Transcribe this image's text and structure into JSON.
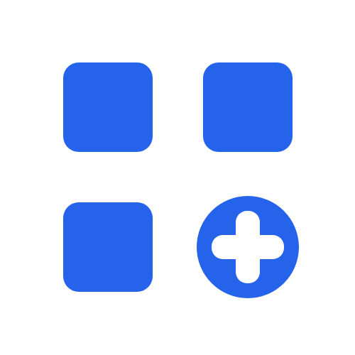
{
  "icon": {
    "name": "grid-add-icon",
    "color": "#2563EB",
    "foreground": "#FFFFFF",
    "background": "#FFFFFF",
    "tiles": [
      {
        "name": "square-icon"
      },
      {
        "name": "square-icon"
      },
      {
        "name": "square-icon"
      }
    ],
    "badge": {
      "name": "plus-icon"
    }
  }
}
